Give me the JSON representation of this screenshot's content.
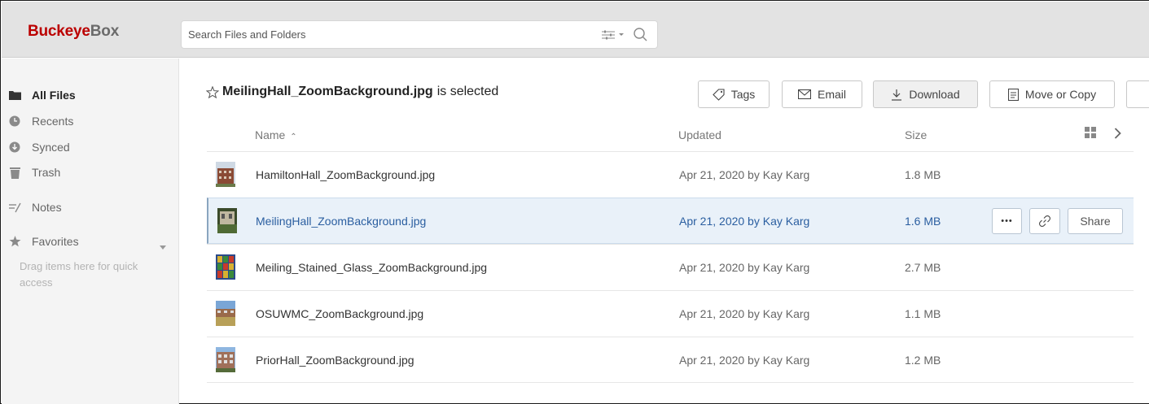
{
  "brand": {
    "part1": "Buckeye",
    "part2": "Box"
  },
  "search": {
    "placeholder": "Search Files and Folders",
    "value": ""
  },
  "sidebar": {
    "items": [
      {
        "label": "All Files",
        "icon": "folder-icon",
        "active": true
      },
      {
        "label": "Recents",
        "icon": "clock-icon"
      },
      {
        "label": "Synced",
        "icon": "sync-icon"
      },
      {
        "label": "Trash",
        "icon": "trash-icon"
      },
      {
        "label": "Notes",
        "icon": "notes-icon"
      },
      {
        "label": "Favorites",
        "icon": "star-icon"
      }
    ],
    "favorites_hint": "Drag items here for quick access"
  },
  "selection": {
    "filename": "MeilingHall_ZoomBackground.jpg",
    "suffix": "is selected"
  },
  "toolbar": {
    "tags_label": "Tags",
    "email_label": "Email",
    "download_label": "Download",
    "move_copy_label": "Move or Copy"
  },
  "columns": {
    "name": "Name",
    "updated": "Updated",
    "size": "Size"
  },
  "files": [
    {
      "name": "HamiltonHall_ZoomBackground.jpg",
      "updated": "Apr 21, 2020 by Kay Karg",
      "size": "1.8 MB"
    },
    {
      "name": "MeilingHall_ZoomBackground.jpg",
      "updated": "Apr 21, 2020 by Kay Karg",
      "size": "1.6 MB",
      "selected": true
    },
    {
      "name": "Meiling_Stained_Glass_ZoomBackground.jpg",
      "updated": "Apr 21, 2020 by Kay Karg",
      "size": "2.7 MB"
    },
    {
      "name": "OSUWMC_ZoomBackground.jpg",
      "updated": "Apr 21, 2020 by Kay Karg",
      "size": "1.1 MB"
    },
    {
      "name": "PriorHall_ZoomBackground.jpg",
      "updated": "Apr 21, 2020 by Kay Karg",
      "size": "1.2 MB"
    }
  ],
  "row_actions": {
    "more_label": "•••",
    "share_label": "Share"
  },
  "colors": {
    "brand_red": "#bb0000",
    "selected_row": "#e9f1f9",
    "selected_text": "#2a5ea0"
  }
}
